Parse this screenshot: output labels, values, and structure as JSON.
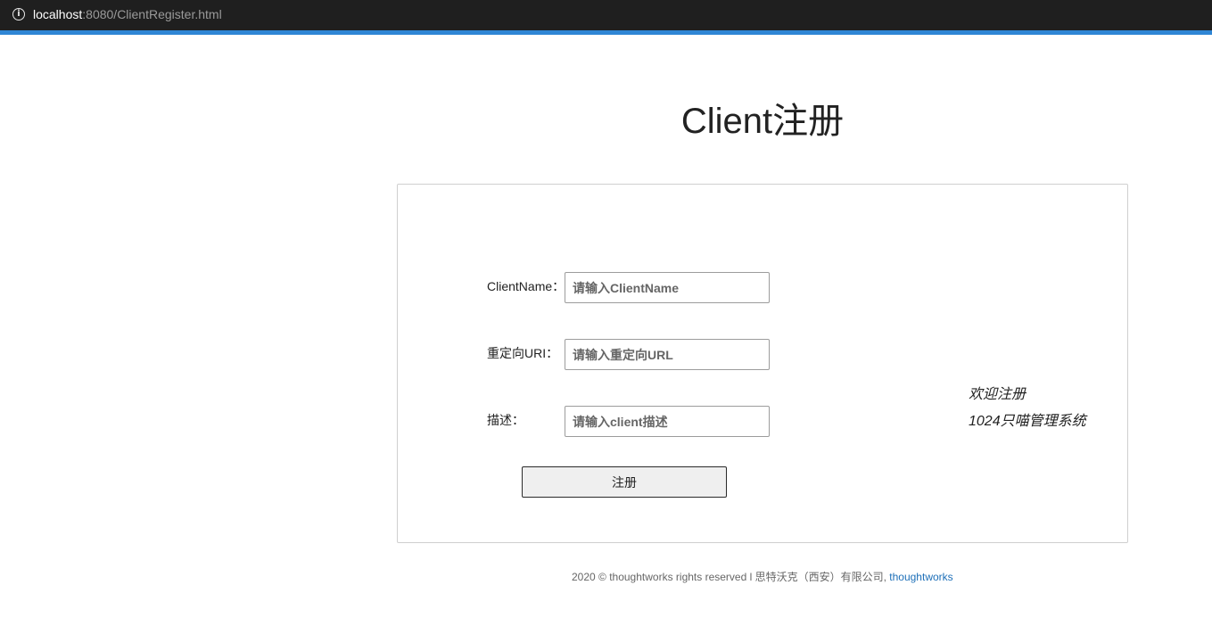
{
  "browser": {
    "url_host": "localhost",
    "url_rest": ":8080/ClientRegister.html",
    "info_icon": "info-icon",
    "accent_color": "#2f86d5"
  },
  "page": {
    "title": "Client注册"
  },
  "form": {
    "client_name": {
      "label": "ClientName：",
      "placeholder": "请输入ClientName",
      "value": ""
    },
    "redirect_uri": {
      "label": "重定向URI：",
      "placeholder": "请输入重定向URL",
      "value": ""
    },
    "description": {
      "label": "描述：",
      "placeholder": "请输入client描述",
      "value": ""
    },
    "submit_label": "注册"
  },
  "welcome": {
    "line1": "欢迎注册",
    "line2": "1024只喵管理系统"
  },
  "footer": {
    "text": "2020 © thoughtworks rights reserved l 思特沃克（西安）有限公司, ",
    "link_text": "thoughtworks",
    "link_color": "#1d6fb8"
  }
}
